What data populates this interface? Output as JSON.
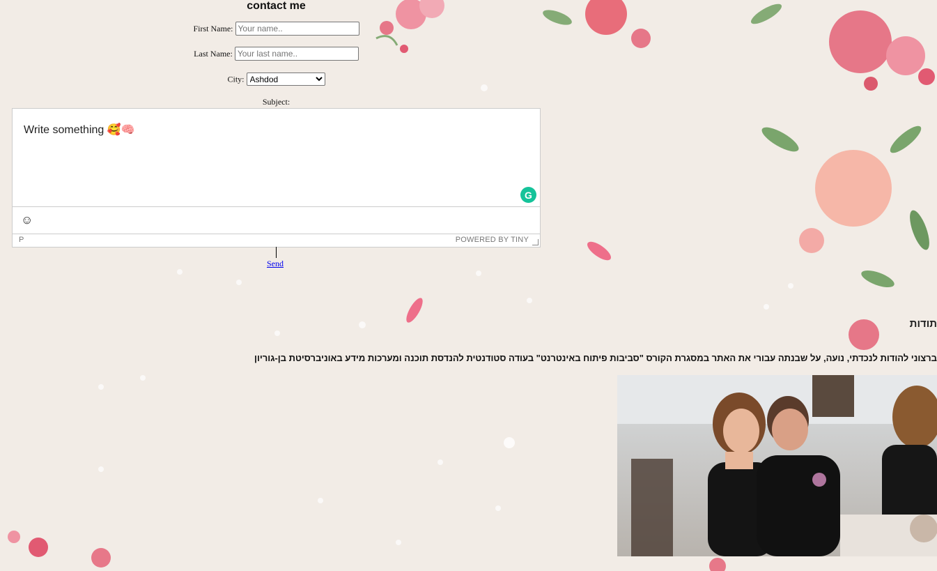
{
  "form": {
    "title": "contact me",
    "first_name_label": "First Name:",
    "first_name_placeholder": "Your name..",
    "last_name_label": "Last Name:",
    "last_name_placeholder": "Your last name..",
    "city_label": "City:",
    "city_selected": "Ashdod",
    "subject_label": "Subject:"
  },
  "editor": {
    "content": "Write something 🥰🧠",
    "status_path": "P",
    "powered_by": "POWERED BY TINY",
    "grammarly_icon": "G",
    "emoji_icon": "☺"
  },
  "send_label": "Send",
  "acknowledgements": {
    "heading": "תודות",
    "text": "ברצוני להודות לנכדתי, נועה, על שבנתה עבורי את האתר במסגרת הקורס \"סביבות פיתוח באינטרנט\" בעודה סטודנטית להנדסת תוכנה ומערכות מידע באוניברסיטת בן-גוריון"
  },
  "colors": {
    "background": "#f2ece6",
    "link": "#0000ee",
    "grammarly": "#15c39a",
    "rose": "#e56b7e"
  }
}
